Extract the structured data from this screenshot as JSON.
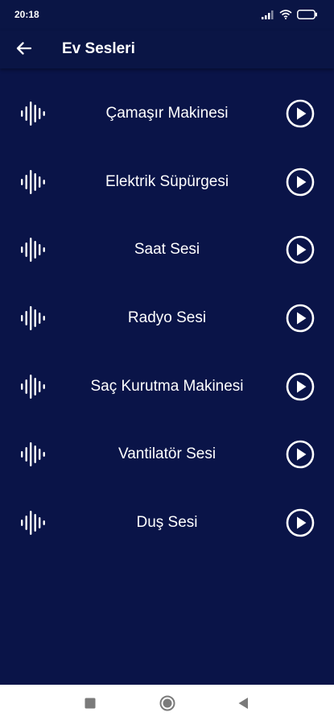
{
  "status_bar": {
    "time": "20:18",
    "icons": [
      "signal-icon",
      "wifi-icon",
      "battery-icon"
    ]
  },
  "app_bar": {
    "title": "Ev Sesleri",
    "back_icon": "arrow-left-icon"
  },
  "sounds": [
    {
      "label": "Çamaşır Makinesi",
      "icon": "sound-wave-icon",
      "action_icon": "play-circle-icon"
    },
    {
      "label": "Elektrik Süpürgesi",
      "icon": "sound-wave-icon",
      "action_icon": "play-circle-icon"
    },
    {
      "label": "Saat Sesi",
      "icon": "sound-wave-icon",
      "action_icon": "play-circle-icon"
    },
    {
      "label": "Radyo Sesi",
      "icon": "sound-wave-icon",
      "action_icon": "play-circle-icon"
    },
    {
      "label": "Saç Kurutma Makinesi",
      "icon": "sound-wave-icon",
      "action_icon": "play-circle-icon"
    },
    {
      "label": "Vantilatör Sesi",
      "icon": "sound-wave-icon",
      "action_icon": "play-circle-icon"
    },
    {
      "label": "Duş Sesi",
      "icon": "sound-wave-icon",
      "action_icon": "play-circle-icon"
    }
  ],
  "nav_bar": {
    "buttons": [
      "recents-square-icon",
      "home-circle-icon",
      "back-triangle-icon"
    ]
  },
  "colors": {
    "background": "#0a1448",
    "app_bar": "#0a1545",
    "text": "#ffffff",
    "nav_bar": "#ffffff",
    "nav_icons": "#7a7a7a"
  }
}
